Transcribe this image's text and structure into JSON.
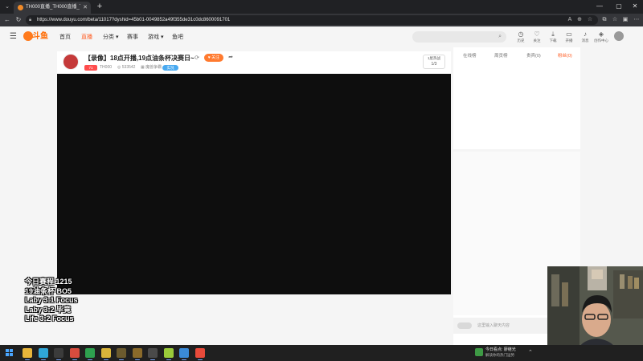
{
  "browser": {
    "tab_list_icon": "chevron-down-icon",
    "tab": {
      "title": "TH000直播_TH000直播_TH000视频",
      "favicon": "douyu-favicon",
      "close": "✕"
    },
    "new_tab": "+",
    "window_controls": {
      "minimize": "—",
      "maximize": "▢",
      "close": "✕"
    },
    "nav": {
      "back": "←",
      "reload": "↻"
    },
    "url": "https://www.douyu.com/beta/11017?dyshid=45b01-0049852a49f355de31c0dc8600091701",
    "omnibox_icons": [
      "translate-icon",
      "zoom-icon",
      "bookmark-star-icon"
    ],
    "toolbar_icons": [
      "extensions-icon",
      "split-screen-icon",
      "favorites-icon",
      "collections-icon",
      "more-icon"
    ]
  },
  "site": {
    "logo_text": "斗鱼",
    "nav": [
      {
        "label": "首页",
        "active": false
      },
      {
        "label": "直播",
        "active": true
      },
      {
        "label": "分类 ▾",
        "active": false
      },
      {
        "label": "赛事",
        "active": false
      },
      {
        "label": "游戏 ▾",
        "active": false
      },
      {
        "label": "鱼吧",
        "active": false
      }
    ],
    "search_placeholder": "",
    "tools": [
      {
        "icon": "history-icon",
        "glyph": "◷",
        "label": "历史"
      },
      {
        "icon": "heart-icon",
        "glyph": "♡",
        "label": "关注"
      },
      {
        "icon": "download-icon",
        "glyph": "⤓",
        "label": "下载"
      },
      {
        "icon": "camera-icon",
        "glyph": "▭",
        "label": "开播"
      },
      {
        "icon": "bell-icon",
        "glyph": "♪",
        "label": "消息"
      },
      {
        "icon": "creator-icon",
        "glyph": "◈",
        "label": "创作中心"
      }
    ]
  },
  "room": {
    "title": "【录像】18点开播,19点油条杯决赛日~",
    "follow_label": "关注",
    "level_badge": "71",
    "anchor_name": "TH000",
    "viewer_count": "533542",
    "category": "魔兽争霸",
    "tag": "实况",
    "hot_label": "1屋热战",
    "hot_page": "1/3"
  },
  "overlay": {
    "lines": [
      "今日赛程 1215",
      "19油条杯 BO5",
      "Laby 3:1 Focus",
      "Laby 3:2 毕竟",
      "Life   3:2 Focus"
    ]
  },
  "rank": {
    "tabs": [
      {
        "label": "在线榜",
        "active": false
      },
      {
        "label": "周贡榜",
        "active": false
      },
      {
        "label": "贵宾(0)",
        "active": false
      },
      {
        "label": "粉丝(0)",
        "active": true
      }
    ]
  },
  "chat": {
    "input_placeholder": "这里输入聊天内容"
  },
  "taskbar": {
    "apps": [
      {
        "name": "start-icon",
        "color": "#4aa6ff"
      },
      {
        "name": "file-explorer-icon",
        "color": "#e8b53a"
      },
      {
        "name": "edge-browser-icon",
        "color": "#2fa6d8"
      },
      {
        "name": "media-app-icon",
        "color": "#3b3b3b"
      },
      {
        "name": "chrome-icon",
        "color": "#d84c3e"
      },
      {
        "name": "green-app-icon",
        "color": "#2ea04f"
      },
      {
        "name": "yellow-app-icon",
        "color": "#d9b43a"
      },
      {
        "name": "game-app-icon",
        "color": "#6b5a2e"
      },
      {
        "name": "wc3-icon",
        "color": "#8a6a2a"
      },
      {
        "name": "editor-app-icon",
        "color": "#4a4a4a"
      },
      {
        "name": "lime-app-icon",
        "color": "#9acb3a"
      },
      {
        "name": "play-app-icon",
        "color": "#3a8ad8"
      },
      {
        "name": "douyu-app-icon",
        "color": "#e84a3a"
      }
    ],
    "weather_title": "今日看点: 廖继光",
    "weather_sub": "解读你的热门运势"
  },
  "colors": {
    "accent": "#ff5d23",
    "follow": "#ff7a2f",
    "player_bg": "#0e0e0e"
  }
}
